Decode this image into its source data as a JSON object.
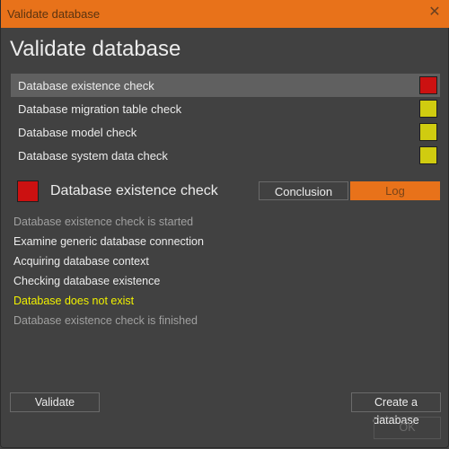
{
  "window": {
    "title": "Validate database",
    "close_icon": "close-icon"
  },
  "heading": "Validate database",
  "checks": [
    {
      "label": "Database existence check",
      "status": "error",
      "color": "#cc1111",
      "selected": true
    },
    {
      "label": "Database migration table check",
      "status": "pending",
      "color": "#d0cc10",
      "selected": false
    },
    {
      "label": "Database model check",
      "status": "pending",
      "color": "#d0cc10",
      "selected": false
    },
    {
      "label": "Database system data check",
      "status": "pending",
      "color": "#d0cc10",
      "selected": false
    }
  ],
  "detail": {
    "title": "Database existence check",
    "status_color": "#cc1111",
    "tabs": [
      {
        "label": "Conclusion",
        "active": false
      },
      {
        "label": "Log",
        "active": true
      }
    ]
  },
  "log": [
    {
      "text": "Database existence check is started",
      "color": "#a0a0a0"
    },
    {
      "text": "Examine generic database connection",
      "color": "#ececec"
    },
    {
      "text": "Acquiring database context",
      "color": "#ececec"
    },
    {
      "text": "Checking database existence",
      "color": "#ececec"
    },
    {
      "text": "Database does not exist",
      "color": "#f0f000"
    },
    {
      "text": "Database existence check is finished",
      "color": "#a0a0a0"
    }
  ],
  "buttons": {
    "validate": "Validate",
    "create": "Create a database",
    "ok": "OK"
  },
  "colors": {
    "accent": "#e8721a",
    "background": "#414141",
    "error": "#cc1111",
    "pending": "#d0cc10",
    "warning_text": "#f0f000"
  }
}
